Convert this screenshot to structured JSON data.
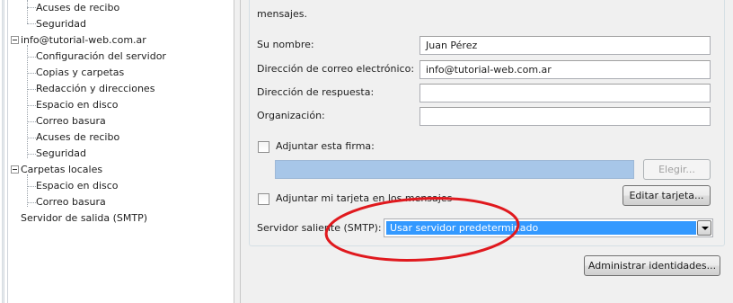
{
  "tree": {
    "partial_items": [
      "Acuses de recibo",
      "Seguridad"
    ],
    "account": {
      "label": "info@tutorial-web.com.ar",
      "children": [
        "Configuración del servidor",
        "Copias y carpetas",
        "Redacción y direcciones",
        "Espacio en disco",
        "Correo basura",
        "Acuses de recibo",
        "Seguridad"
      ]
    },
    "local_folders": {
      "label": "Carpetas locales",
      "children": [
        "Espacio en disco",
        "Correo basura"
      ]
    },
    "smtp_item": "Servidor de salida (SMTP)"
  },
  "form": {
    "partial_text": "mensajes.",
    "name_label": "Su nombre:",
    "name_value": "Juan Pérez",
    "email_label": "Dirección de correo electrónico:",
    "email_value": "info@tutorial-web.com.ar",
    "reply_label": "Dirección de respuesta:",
    "reply_value": "",
    "org_label": "Organización:",
    "org_value": "",
    "attach_signature_label": "Adjuntar esta firma:",
    "choose_button": "Elegir...",
    "attach_vcard_label": "Adjuntar mi tarjeta en los mensajes",
    "edit_card_button": "Editar tarjeta...",
    "smtp_label": "Servidor saliente (SMTP):",
    "smtp_selected": "Usar servidor predeterminado",
    "manage_identities_button": "Administrar identidades..."
  },
  "colors": {
    "selection": "#3399ff",
    "annotation_ellipse": "#e0191e",
    "signature_field": "#a7c6e8"
  }
}
